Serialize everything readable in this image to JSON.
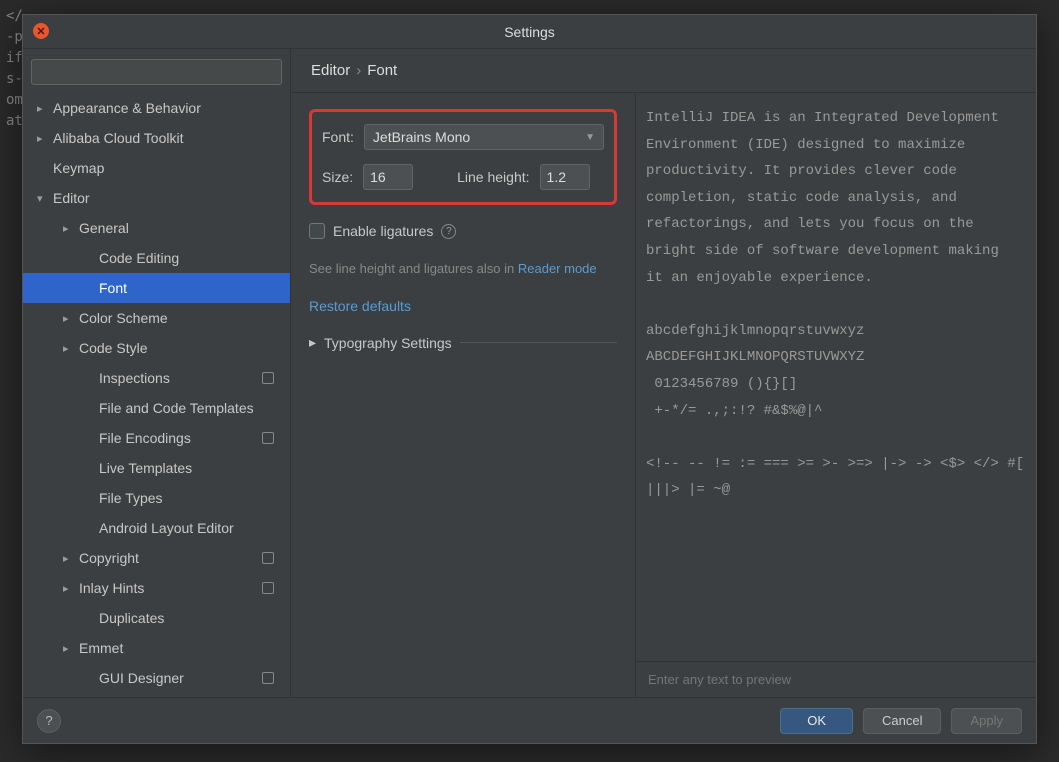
{
  "background_code_lines": [
    "</…",
    "",
    "-p…",
    "if…",
    "s-…",
    "",
    "",
    "",
    "om…",
    "at…"
  ],
  "title": "Settings",
  "search_placeholder": "",
  "sidebar": {
    "items": [
      {
        "label": "Appearance & Behavior",
        "depth": 0,
        "state": "collapsed"
      },
      {
        "label": "Alibaba Cloud Toolkit",
        "depth": 0,
        "state": "collapsed"
      },
      {
        "label": "Keymap",
        "depth": 0,
        "state": "none"
      },
      {
        "label": "Editor",
        "depth": 0,
        "state": "expanded"
      },
      {
        "label": "General",
        "depth": 1,
        "state": "collapsed"
      },
      {
        "label": "Code Editing",
        "depth": 2,
        "state": "none"
      },
      {
        "label": "Font",
        "depth": 2,
        "state": "none",
        "selected": true
      },
      {
        "label": "Color Scheme",
        "depth": 1,
        "state": "collapsed"
      },
      {
        "label": "Code Style",
        "depth": 1,
        "state": "collapsed"
      },
      {
        "label": "Inspections",
        "depth": 2,
        "state": "none",
        "badge": true
      },
      {
        "label": "File and Code Templates",
        "depth": 2,
        "state": "none"
      },
      {
        "label": "File Encodings",
        "depth": 2,
        "state": "none",
        "badge": true
      },
      {
        "label": "Live Templates",
        "depth": 2,
        "state": "none"
      },
      {
        "label": "File Types",
        "depth": 2,
        "state": "none"
      },
      {
        "label": "Android Layout Editor",
        "depth": 2,
        "state": "none"
      },
      {
        "label": "Copyright",
        "depth": 1,
        "state": "collapsed",
        "badge": true
      },
      {
        "label": "Inlay Hints",
        "depth": 1,
        "state": "collapsed",
        "badge": true
      },
      {
        "label": "Duplicates",
        "depth": 2,
        "state": "none"
      },
      {
        "label": "Emmet",
        "depth": 1,
        "state": "collapsed"
      },
      {
        "label": "GUI Designer",
        "depth": 2,
        "state": "none",
        "badge": true
      }
    ]
  },
  "breadcrumb": {
    "root": "Editor",
    "sep": "›",
    "leaf": "Font"
  },
  "form": {
    "font_label": "Font:",
    "font_value": "JetBrains Mono",
    "size_label": "Size:",
    "size_value": "16",
    "line_height_label": "Line height:",
    "line_height_value": "1.2",
    "ligatures_label": "Enable ligatures",
    "hint_prefix": "See line height and ligatures also in ",
    "hint_link": "Reader mode",
    "restore": "Restore defaults",
    "typography_section": "Typography Settings"
  },
  "preview": {
    "text": "IntelliJ IDEA is an Integrated Development Environment (IDE) designed to maximize productivity. It provides clever code completion, static code analysis, and refactorings, and lets you focus on the bright side of software development making\nit an enjoyable experience.\n\nabcdefghijklmnopqrstuvwxyz\nABCDEFGHIJKLMNOPQRSTUVWXYZ\n 0123456789 (){}[]\n +-*/= .,;:!? #&$%@|^\n\n<!-- -- != := === >= >- >=> |-> -> <$> </> #[ |||> |= ~@",
    "input_placeholder": "Enter any text to preview"
  },
  "footer": {
    "ok": "OK",
    "cancel": "Cancel",
    "apply": "Apply"
  }
}
